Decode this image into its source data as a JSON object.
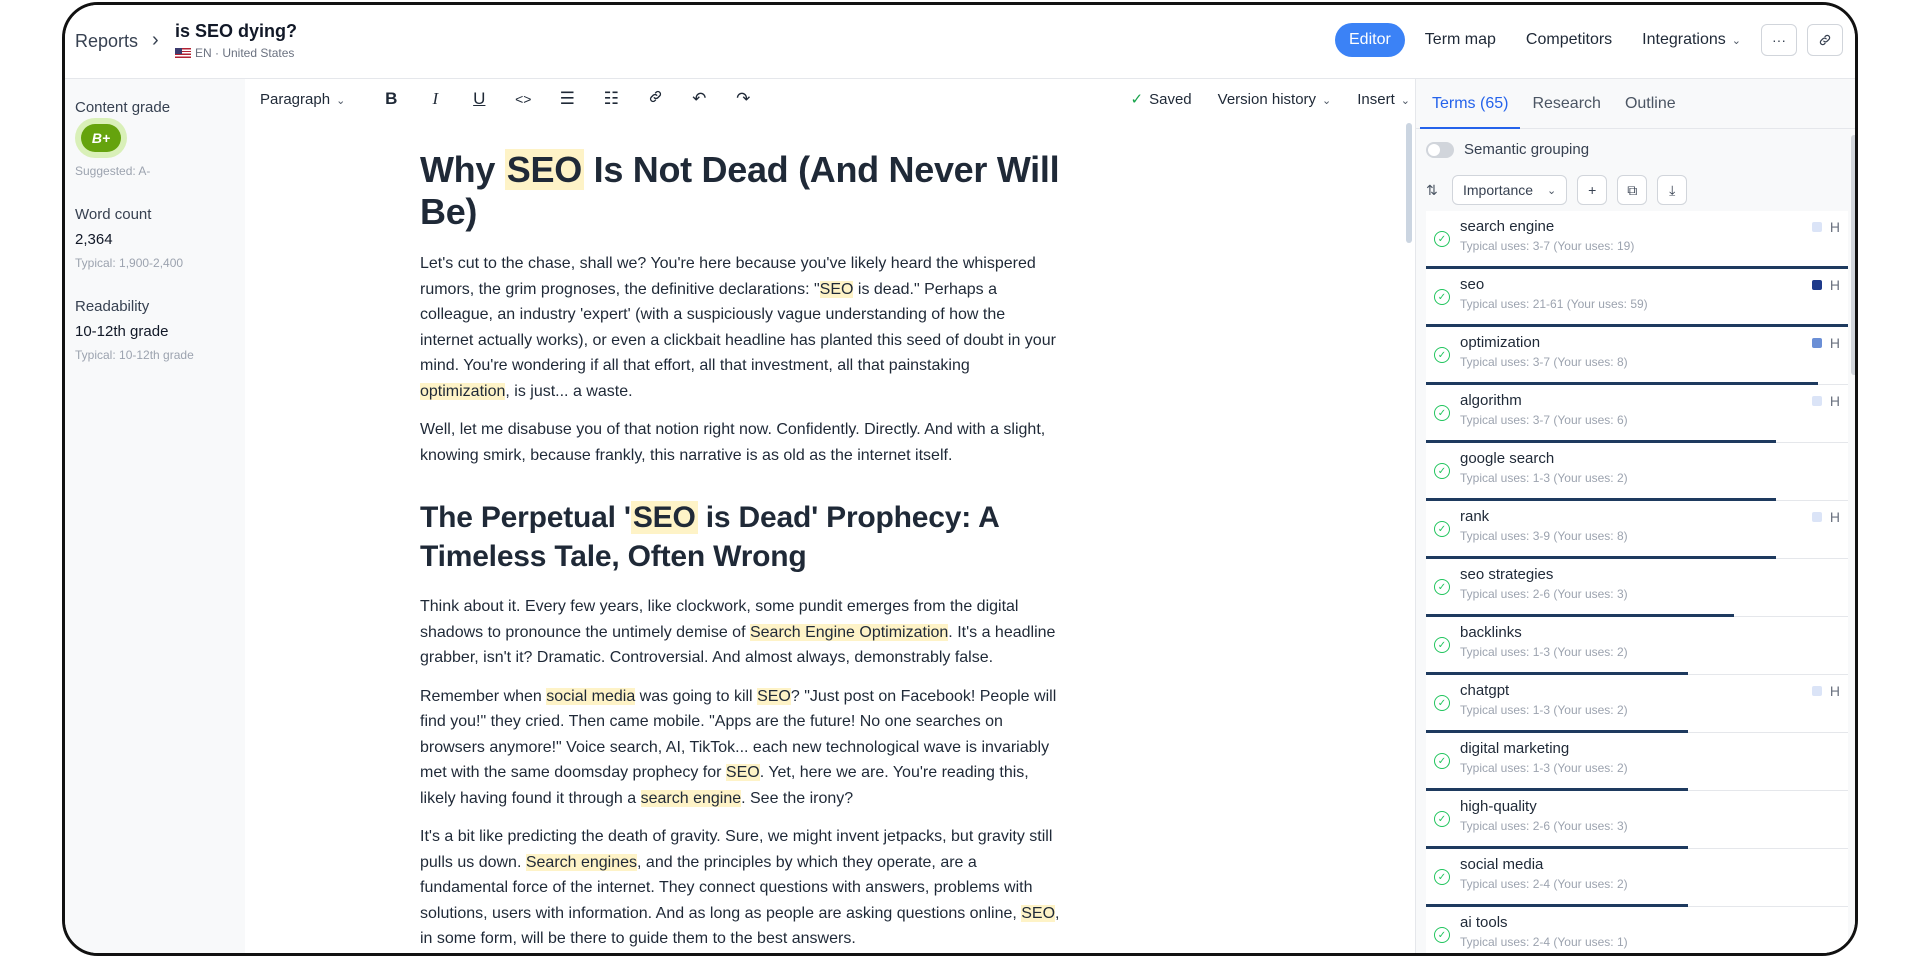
{
  "header": {
    "breadcrumb_root": "Reports",
    "breadcrumb_sep": "›",
    "title": "is SEO dying?",
    "locale": "EN · United States",
    "nav": [
      {
        "label": "Editor",
        "active": true
      },
      {
        "label": "Term map"
      },
      {
        "label": "Competitors"
      },
      {
        "label": "Integrations"
      }
    ],
    "more_icon": "···",
    "link_icon": "⛓"
  },
  "left": {
    "content_grade_label": "Content grade",
    "grade": "B+",
    "suggested": "Suggested: A-",
    "word_count_label": "Word count",
    "word_count": "2,364",
    "word_typical": "Typical: 1,900-2,400",
    "readability_label": "Readability",
    "readability": "10-12th grade",
    "readability_typical": "Typical: 10-12th grade"
  },
  "toolbar": {
    "paragraph": "Paragraph",
    "saved": "Saved",
    "version_history": "Version history",
    "insert": "Insert",
    "more": "···"
  },
  "doc": {
    "h1_pre": "Why ",
    "h1_hl": "SEO",
    "h1_post": " Is Not Dead (And Never Will Be)",
    "p1a": "Let's cut to the chase, shall we? You're here because you've likely heard the whispered rumors, the grim prognoses, the definitive declarations: \"",
    "p1b": "SEO",
    "p1c": " is dead.\" Perhaps a colleague, an industry 'expert' (with a suspiciously vague understanding of how the internet actually works), or even a clickbait headline has planted this seed of doubt in your mind. You're wondering if all that effort, all that investment, all that painstaking ",
    "p1d": "optimization",
    "p1e": ", is just... a waste.",
    "p2": "Well, let me disabuse you of that notion right now. Confidently. Directly. And with a slight, knowing smirk, because frankly, this narrative is as old as the internet itself.",
    "h2_pre": "The Perpetual '",
    "h2_hl": "SEO",
    "h2_post": " is Dead' Prophecy: A Timeless Tale, Often Wrong",
    "p3a": "Think about it. Every few years, like clockwork, some pundit emerges from the digital shadows to pronounce the untimely demise of ",
    "p3b": "Search Engine Optimization",
    "p3c": ". It's a headline grabber, isn't it? Dramatic. Controversial. And almost always, demonstrably false.",
    "p4a": "Remember when ",
    "p4b": "social media",
    "p4c": " was going to kill ",
    "p4d": "SEO",
    "p4e": "? \"Just post on Facebook! People will find you!\" they cried. Then came mobile. \"Apps are the future! No one searches on browsers anymore!\" Voice search, AI, TikTok... each new technological wave is invariably met with the same doomsday prophecy for ",
    "p4f": "SEO",
    "p4g": ". Yet, here we are. You're reading this, likely having found it through a ",
    "p4h": "search engine",
    "p4i": ". See the irony?",
    "p5a": "It's a bit like predicting the death of gravity. Sure, we might invent jetpacks, but gravity still pulls us down. ",
    "p5b": "Search engines",
    "p5c": ", and the principles by which they operate, are a fundamental force of the internet. They connect questions with answers, problems with solutions, users with information. And as long as people are asking questions online, ",
    "p5d": "SEO",
    "p5e": ", in some form, will be there to guide them to the best answers."
  },
  "terms_panel": {
    "tabs": [
      "Terms (65)",
      "Research",
      "Outline"
    ],
    "semantic_grouping": "Semantic grouping",
    "sort": "Importance",
    "terms": [
      {
        "name": "search engine",
        "uses": "Typical uses: 3-7 (Your uses: 19)",
        "h": "H",
        "hcolor": "#dbe4f7",
        "progress": 1.0
      },
      {
        "name": "seo",
        "uses": "Typical uses: 21-61 (Your uses: 59)",
        "h": "H",
        "hcolor": "#1e3a8a",
        "progress": 1.0
      },
      {
        "name": "optimization",
        "uses": "Typical uses: 3-7 (Your uses: 8)",
        "h": "H",
        "hcolor": "#6b8fd6",
        "progress": 0.93
      },
      {
        "name": "algorithm",
        "uses": "Typical uses: 3-7 (Your uses: 6)",
        "h": "H",
        "hcolor": "#dbe4f7",
        "progress": 0.83
      },
      {
        "name": "google search",
        "uses": "Typical uses: 1-3 (Your uses: 2)",
        "h": "",
        "hcolor": "",
        "progress": 0.83
      },
      {
        "name": "rank",
        "uses": "Typical uses: 3-9 (Your uses: 8)",
        "h": "H",
        "hcolor": "#dbe4f7",
        "progress": 0.83
      },
      {
        "name": "seo strategies",
        "uses": "Typical uses: 2-6 (Your uses: 3)",
        "h": "",
        "hcolor": "",
        "progress": 0.73
      },
      {
        "name": "backlinks",
        "uses": "Typical uses: 1-3 (Your uses: 2)",
        "h": "",
        "hcolor": "",
        "progress": 0.62
      },
      {
        "name": "chatgpt",
        "uses": "Typical uses: 1-3 (Your uses: 2)",
        "h": "H",
        "hcolor": "#dbe4f7",
        "progress": 0.62
      },
      {
        "name": "digital marketing",
        "uses": "Typical uses: 1-3 (Your uses: 2)",
        "h": "",
        "hcolor": "",
        "progress": 0.62
      },
      {
        "name": "high-quality",
        "uses": "Typical uses: 2-6 (Your uses: 3)",
        "h": "",
        "hcolor": "",
        "progress": 0.62
      },
      {
        "name": "social media",
        "uses": "Typical uses: 2-4 (Your uses: 2)",
        "h": "",
        "hcolor": "",
        "progress": 0.62
      },
      {
        "name": "ai tools",
        "uses": "Typical uses: 2-4 (Your uses: 1)",
        "h": "",
        "hcolor": "",
        "progress": 0.48
      }
    ]
  },
  "colors": {
    "accent": "#3b82f6",
    "highlight": "#fef3c7",
    "grade_green": "#65a30d",
    "check_green": "#22c55e",
    "progress_bar": "#1e3a5f"
  }
}
